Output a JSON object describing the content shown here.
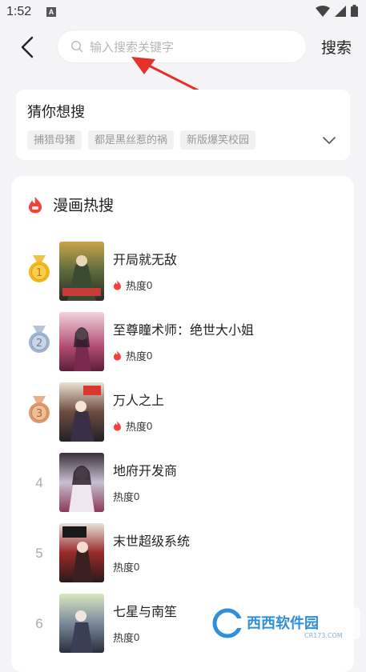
{
  "status_bar": {
    "time": "1:52",
    "notification_glyph": "A"
  },
  "header": {
    "search_placeholder": "输入搜索关键字",
    "search_button_label": "搜索"
  },
  "guess": {
    "title": "猜你想搜",
    "tags": [
      "捕猎母猪",
      "都是黑丝惹的祸",
      "新版爆笑校园"
    ]
  },
  "hot": {
    "title": "漫画热搜",
    "heat_label": "热度",
    "items": [
      {
        "rank": "1",
        "title": "开局就无敌",
        "heat": "0",
        "medal": "gold"
      },
      {
        "rank": "2",
        "title": "至尊瞳术师：绝世大小姐",
        "heat": "0",
        "medal": "silver"
      },
      {
        "rank": "3",
        "title": "万人之上",
        "heat": "0",
        "medal": "bronze"
      },
      {
        "rank": "4",
        "title": "地府开发商",
        "heat": "0"
      },
      {
        "rank": "5",
        "title": "末世超级系统",
        "heat": "0"
      },
      {
        "rank": "6",
        "title": "七星与南笙",
        "heat": "0"
      }
    ]
  },
  "watermark": {
    "text": "西西软件园",
    "url": "CR173.COM"
  },
  "colors": {
    "background": "#f4f4f6",
    "card": "#ffffff",
    "flame": "#f0443b",
    "annotation_arrow": "#e8302a",
    "gold": "#f3b61f",
    "silver": "#9fb2cf",
    "bronze": "#dc9a6a"
  },
  "icons": [
    "back-arrow-icon",
    "search-icon",
    "chevron-down-icon",
    "flame-icon",
    "medal-icon",
    "wifi-icon",
    "signal-icon",
    "battery-icon"
  ]
}
